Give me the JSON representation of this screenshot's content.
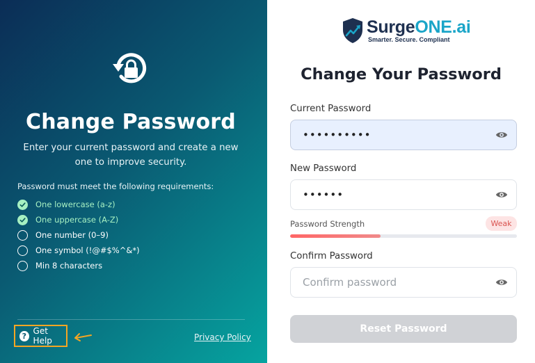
{
  "left_panel": {
    "title": "Change Password",
    "subtitle": "Enter your current password and create a new one to improve security.",
    "requirements_title": "Password must meet the following requirements:",
    "requirements": [
      {
        "label": "One lowercase (a-z)",
        "met": true
      },
      {
        "label": "One uppercase (A-Z)",
        "met": true
      },
      {
        "label": "One number (0–9)",
        "met": false
      },
      {
        "label": "One symbol (!@#$%^&*)",
        "met": false
      },
      {
        "label": "Min 8 characters",
        "met": false
      }
    ],
    "get_help_label": "Get Help",
    "privacy_policy_label": "Privacy Policy"
  },
  "logo": {
    "name_primary": "Surge",
    "name_accent": "ONE.ai",
    "tagline": "Smarter. Secure. Compliant"
  },
  "form": {
    "title": "Change Your Password",
    "current_password": {
      "label": "Current Password",
      "value": "••••••••••"
    },
    "new_password": {
      "label": "New Password",
      "value": "••••••"
    },
    "strength": {
      "label": "Password Strength",
      "badge": "Weak",
      "fraction": 0.4
    },
    "confirm_password": {
      "label": "Confirm Password",
      "placeholder": "Confirm password"
    },
    "reset_button_label": "Reset Password"
  },
  "colors": {
    "accent": "#1aa5c8",
    "navy": "#1e3050",
    "met": "#a6f0c2",
    "weak": "#d9534f",
    "highlight": "#f5a623"
  }
}
